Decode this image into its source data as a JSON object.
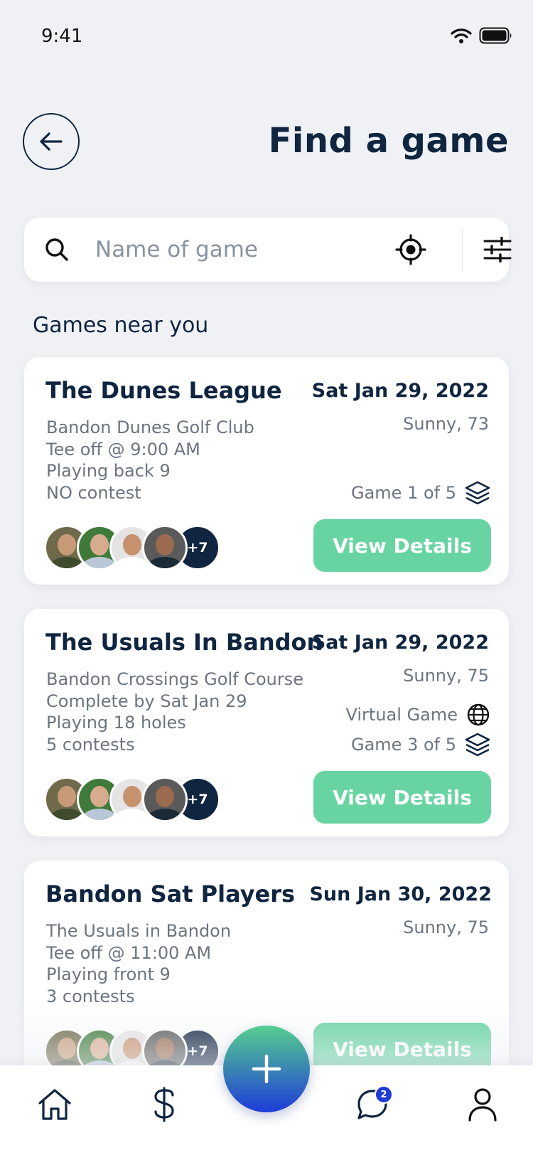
{
  "status": {
    "time": "9:41"
  },
  "header": {
    "title": "Find a game",
    "back_icon": "arrow-left-icon"
  },
  "search": {
    "value": "",
    "placeholder": "Name of game"
  },
  "section_title": "Games near you",
  "colors": {
    "navy": "#0f2540",
    "accent_green": "#67d4a2",
    "badge_blue": "#1e3bd8",
    "muted_text": "#6b7480"
  },
  "games": [
    {
      "title": "The Dunes League",
      "date": "Sat Jan 29, 2022",
      "weather": "Sunny, 73",
      "lines": [
        "Bandon Dunes Golf Club",
        "Tee off @ 9:00 AM",
        "Playing back 9",
        "NO contest"
      ],
      "virtual_label": "",
      "game_count": "Game 1 of 5",
      "more_players": "+7",
      "button_label": "View Details"
    },
    {
      "title": "The Usuals In Bandon",
      "date": "Sat Jan 29, 2022",
      "weather": "Sunny, 75",
      "lines": [
        "Bandon Crossings Golf Course",
        "Complete by Sat Jan 29",
        "Playing 18 holes",
        "5 contests"
      ],
      "virtual_label": "Virtual Game",
      "game_count": "Game 3 of 5",
      "more_players": "+7",
      "button_label": "View Details"
    },
    {
      "title": "Bandon Sat Players",
      "date": "Sun Jan 30, 2022",
      "weather": "Sunny, 75",
      "lines": [
        "The Usuals in Bandon",
        "Tee off @ 11:00 AM",
        "Playing front 9",
        "3 contests"
      ],
      "virtual_label": "",
      "game_count": "",
      "more_players": "+7",
      "button_label": "View Details"
    }
  ],
  "tabbar": {
    "items": [
      {
        "name": "home",
        "icon": "home-icon"
      },
      {
        "name": "money",
        "icon": "dollar-icon"
      },
      {
        "name": "messages",
        "icon": "chat-icon",
        "badge": "2"
      },
      {
        "name": "profile",
        "icon": "user-icon"
      }
    ],
    "fab_icon": "plus-icon"
  }
}
